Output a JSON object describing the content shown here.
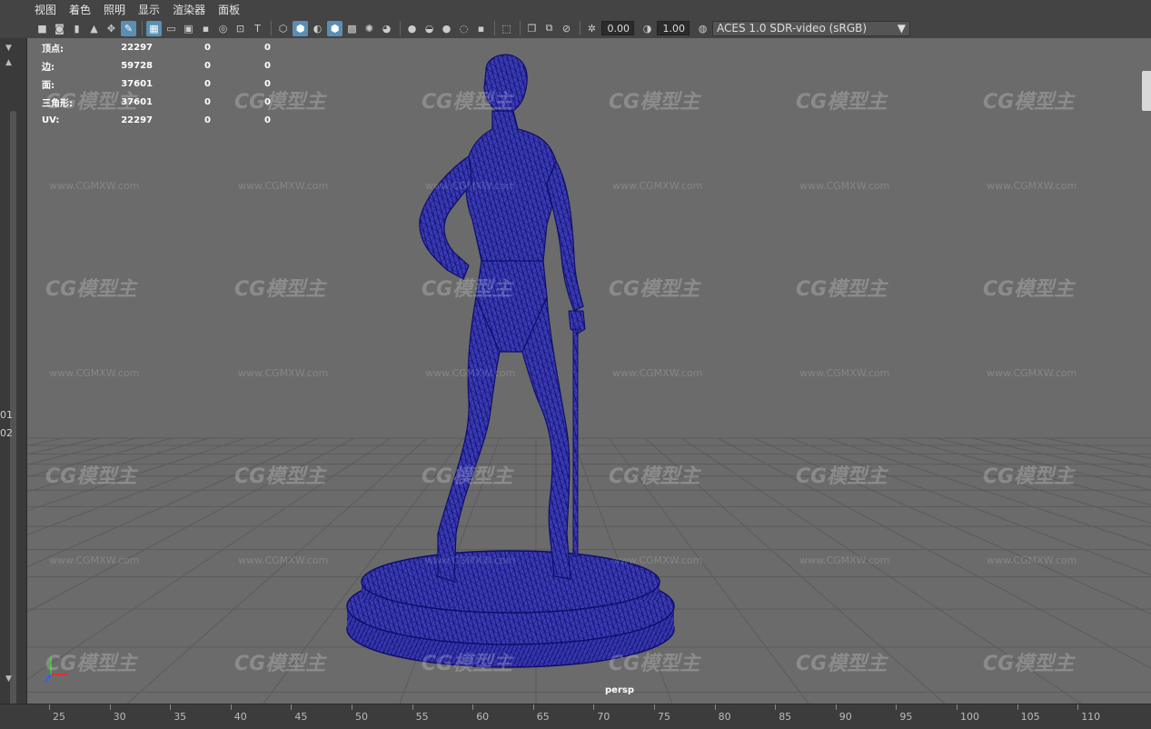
{
  "menu": [
    "视图",
    "着色",
    "照明",
    "显示",
    "渲染器",
    "面板"
  ],
  "toolbar": {
    "exposure": "0.00",
    "gamma": "1.00",
    "color_space": "ACES 1.0 SDR-video (sRGB)"
  },
  "hud": {
    "rows": [
      {
        "label": "顶点:",
        "v1": "22297",
        "v2": "0",
        "v3": "0"
      },
      {
        "label": "边:",
        "v1": "59728",
        "v2": "0",
        "v3": "0"
      },
      {
        "label": "面:",
        "v1": "37601",
        "v2": "0",
        "v3": "0"
      },
      {
        "label": "三角形:",
        "v1": "37601",
        "v2": "0",
        "v3": "0"
      },
      {
        "label": "UV:",
        "v1": "22297",
        "v2": "0",
        "v3": "0"
      }
    ]
  },
  "camera_label": "persp",
  "left_strip": {
    "num1": "01",
    "num2": "02"
  },
  "watermark": {
    "logo": "CG模型主",
    "url": "www.CGMXW.com"
  },
  "timeline": {
    "ticks": [
      "25",
      "30",
      "35",
      "40",
      "45",
      "50",
      "55",
      "60",
      "65",
      "70",
      "75",
      "80",
      "85",
      "90",
      "95",
      "100",
      "105",
      "110"
    ]
  },
  "colors": {
    "viewport_bg": "#6b6b6b",
    "wireframe": "#1f1f9a",
    "grid": "#5a5a5a"
  }
}
